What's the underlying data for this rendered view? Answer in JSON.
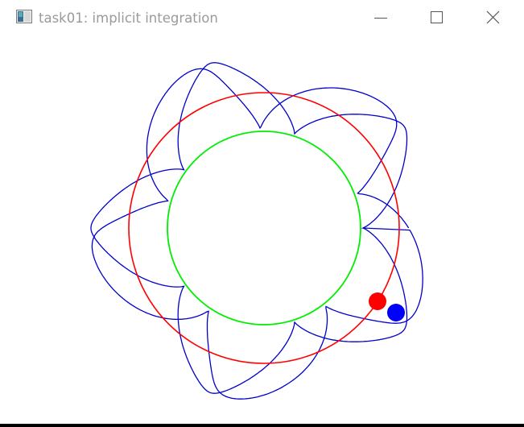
{
  "window": {
    "title": "task01: implicit integration"
  },
  "titlebar_buttons": {
    "minimize_icon": "minimize-icon",
    "maximize_icon": "maximize-icon",
    "close_icon": "close-icon"
  },
  "colors": {
    "background": "#ffffff",
    "title_text": "#9a9a9a",
    "hoop_circle": "#ff0000",
    "inner_circle": "#00ee00",
    "trajectory": "#0000cc",
    "red_ball": "#ff0000",
    "blue_ball": "#0000ff"
  }
}
